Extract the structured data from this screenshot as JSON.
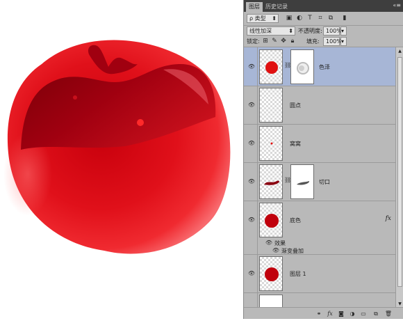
{
  "panel": {
    "tabs": [
      "图层",
      "历史记录"
    ],
    "menu_glyph": "«≡",
    "filter": {
      "value": "ρ 类型",
      "icons": [
        "image-filter-icon",
        "adjustment-filter-icon",
        "type-filter-icon",
        "shape-filter-icon",
        "smart-object-filter-icon",
        "filter-toggle-icon"
      ]
    },
    "blend": {
      "mode": "线性加深",
      "opacity_label": "不透明度:",
      "opacity_value": "100%"
    },
    "lock": {
      "label": "锁定:",
      "fill_label": "填充:",
      "fill_value": "100%"
    },
    "layers": [
      {
        "name": "色泽",
        "visible": true,
        "selected": true,
        "has_mask": true
      },
      {
        "name": "圆点",
        "visible": true,
        "selected": false,
        "has_mask": false
      },
      {
        "name": "窝窝",
        "visible": true,
        "selected": false,
        "has_mask": false
      },
      {
        "name": "切口",
        "visible": true,
        "selected": false,
        "has_mask": true
      },
      {
        "name": "底色",
        "visible": true,
        "selected": false,
        "has_mask": false,
        "fx": "fx",
        "effects_label": "效果",
        "effect": "渐变叠加"
      },
      {
        "name": "图层 1",
        "visible": true,
        "selected": false,
        "has_mask": false
      }
    ],
    "footer_icons": [
      "link-icon",
      "fx-icon",
      "add-mask-icon",
      "adjustment-layer-icon",
      "new-group-icon",
      "new-layer-icon",
      "trash-icon"
    ],
    "footer_fx": "fx"
  },
  "colors": {
    "apple": "#e01010",
    "selection": "#a7b6d6"
  }
}
